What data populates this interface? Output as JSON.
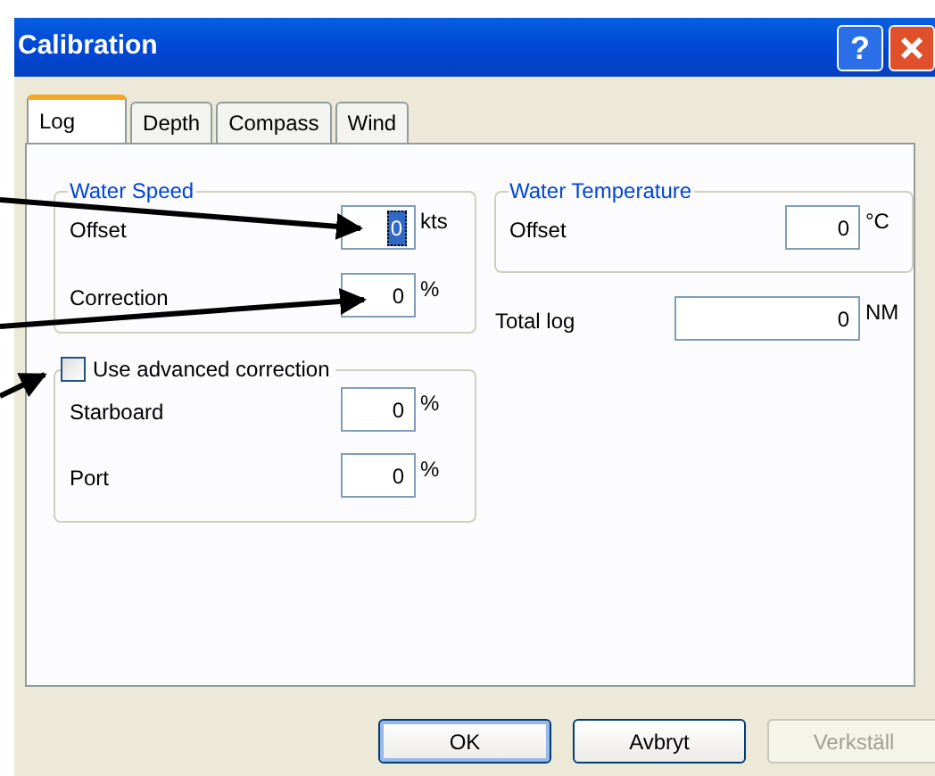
{
  "window": {
    "title": "Calibration",
    "help": "?"
  },
  "tabs": [
    {
      "label": "Log",
      "selected": true
    },
    {
      "label": "Depth",
      "selected": false
    },
    {
      "label": "Compass",
      "selected": false
    },
    {
      "label": "Wind",
      "selected": false
    }
  ],
  "water_speed": {
    "title": "Water Speed",
    "rows": [
      {
        "label": "Offset",
        "value": "0",
        "unit": "kts",
        "highlighted": true
      },
      {
        "label": "Correction",
        "value": "0",
        "unit": "%",
        "highlighted": false
      }
    ]
  },
  "water_temperature": {
    "title": "Water Temperature",
    "rows": [
      {
        "label": "Offset",
        "value": "0",
        "unit": "°C",
        "highlighted": false
      }
    ]
  },
  "total_log": {
    "label": "Total log",
    "value": "0",
    "unit": "NM",
    "highlighted": false
  },
  "advanced": {
    "label": "Use advanced correction",
    "checked": false,
    "rows": [
      {
        "label": "Starboard",
        "value": "0",
        "unit": "%",
        "highlighted": false
      },
      {
        "label": "Port",
        "value": "0",
        "unit": "%",
        "highlighted": false
      }
    ]
  },
  "buttons": [
    {
      "label": "OK",
      "disabled": false,
      "default": true
    },
    {
      "label": "Avbryt",
      "disabled": false,
      "default": false
    },
    {
      "label": "Verkställ",
      "disabled": true,
      "default": false
    }
  ]
}
